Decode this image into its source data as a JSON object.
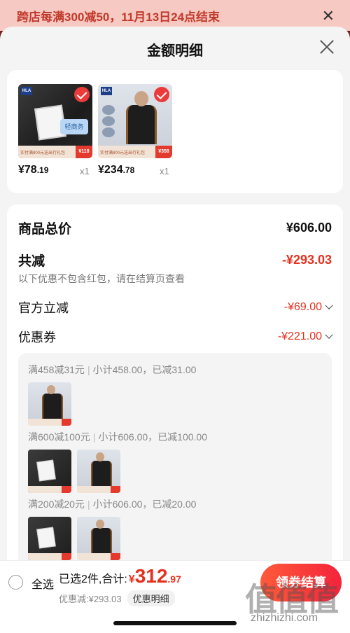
{
  "promo_banner": {
    "text": "跨店每满300减50，11月13日24点结束"
  },
  "sheet": {
    "title": "金额明细"
  },
  "products": [
    {
      "price_int": "¥78",
      "price_dec": ".19",
      "qty": "x1",
      "promo_text": "实付满800元送出行礼包",
      "promo_tag": "¥118",
      "brand": "HLA",
      "label": "轻商务"
    },
    {
      "price_int": "¥234",
      "price_dec": ".78",
      "qty": "x1",
      "promo_text": "实付满800元送出行礼包",
      "promo_tag": "¥358",
      "brand": "HLA"
    }
  ],
  "summary": {
    "total_label": "商品总价",
    "total_value": "¥606.00",
    "reduce_label": "共减",
    "reduce_value": "-¥293.03",
    "note": "以下优惠不包含红包，请在结算页查看",
    "official_label": "官方立减",
    "official_value": "-¥69.00",
    "coupon_label": "优惠券",
    "coupon_value": "-¥221.00"
  },
  "coupon_rules": [
    {
      "rule": "满458减31元",
      "detail": "小计458.00，已减31.00"
    },
    {
      "rule": "满600减100元",
      "detail": "小计606.00，已减100.00"
    },
    {
      "rule": "满200减20元",
      "detail": "小计606.00，已减20.00"
    }
  ],
  "bottom_bar": {
    "select_all": "全选",
    "selected_text": "已选2件,合计:",
    "yen": "¥",
    "total_int": "312",
    "total_dec": ".97",
    "discount_text": "优惠减:¥293.03",
    "detail_chip": "优惠明细",
    "checkout_label": "领券结算"
  },
  "watermark": {
    "logo": "值值值",
    "url": "zhizhizhi.com"
  },
  "colors": {
    "accent_red": "#e4311f",
    "checkout_gradient_start": "#ff5a3a",
    "checkout_gradient_end": "#f3233b"
  }
}
